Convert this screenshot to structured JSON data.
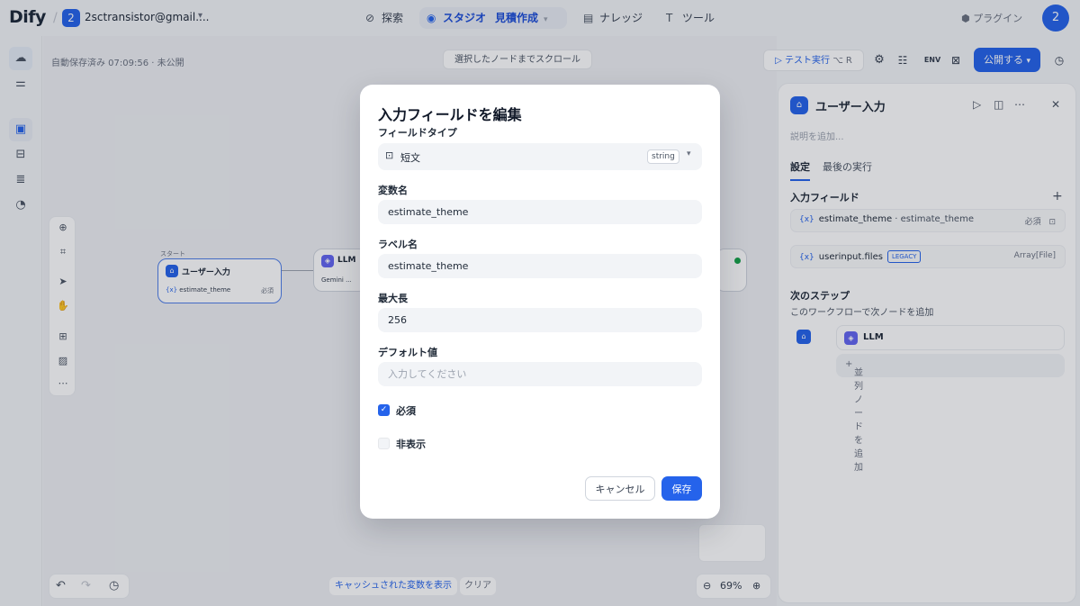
{
  "topbar": {
    "logo": "Dify",
    "workspace_initial": "2",
    "workspace_name": "2sctransistor@gmail....",
    "nav_explore": "探索",
    "nav_studio": "スタジオ",
    "nav_studio_app": "見積作成",
    "nav_knowledge": "ナレッジ",
    "nav_tools": "ツール",
    "plugins": "プラグイン",
    "avatar_initial": "2"
  },
  "canvas": {
    "autosave": "自動保存済み 07:09:56 · 未公開",
    "scroll_to_selected": "選択したノードまでスクロール",
    "show_cached_vars": "キャッシュされた変数を表示",
    "clear": "クリア",
    "zoom": "69%",
    "start_node": {
      "tag": "スタート",
      "title": "ユーザー入力",
      "var": "estimate_theme",
      "required": "必須"
    },
    "llm_node": {
      "title": "LLM",
      "model": "Gemini ..."
    }
  },
  "toolbar": {
    "test_run": "テスト実行",
    "test_run_shortcut": "⌥ R",
    "publish": "公開する"
  },
  "panel": {
    "title": "ユーザー入力",
    "description_placeholder": "説明を追加...",
    "tab_settings": "設定",
    "tab_last_run": "最後の実行",
    "input_fields_label": "入力フィールド",
    "fields": [
      {
        "name": "estimate_theme",
        "label": "estimate_theme",
        "right": "必須"
      },
      {
        "name": "userinput.files",
        "badge": "LEGACY",
        "right": "Array[File]"
      }
    ],
    "next_step_label": "次のステップ",
    "next_step_sub": "このワークフローで次ノードを追加",
    "next_node": "LLM",
    "add_parallel": "並列ノードを追加"
  },
  "modal": {
    "title": "入力フィールドを編集",
    "field_type_label": "フィールドタイプ",
    "field_type_value": "短文",
    "field_type_tag": "string",
    "var_name_label": "変数名",
    "var_name_value": "estimate_theme",
    "label_name_label": "ラベル名",
    "label_name_value": "estimate_theme",
    "max_length_label": "最大長",
    "max_length_value": "256",
    "default_label": "デフォルト値",
    "default_placeholder": "入力してください",
    "required_label": "必須",
    "hidden_label": "非表示",
    "cancel": "キャンセル",
    "save": "保存"
  },
  "colors": {
    "accent": "#2563eb",
    "overlay": "#101828"
  }
}
